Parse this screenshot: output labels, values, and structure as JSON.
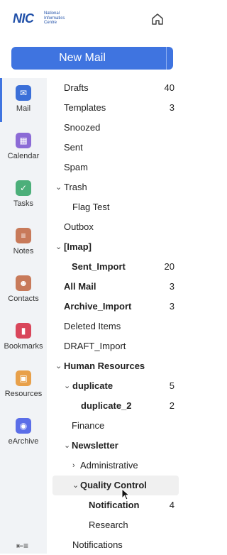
{
  "header": {
    "logo_mark": "NIC",
    "logo_text": "National Informatics Centre",
    "home_icon": "home-icon"
  },
  "compose": {
    "label": "New Mail",
    "dropdown_icon": "chevron-down-icon"
  },
  "colors": {
    "accent": "#3f74e0",
    "mail": "#3b6fd8",
    "calendar": "#8c6bd6",
    "tasks": "#4caf7a",
    "notes": "#c87a5a",
    "contacts": "#c87a5a",
    "bookmarks": "#d9465b",
    "resources": "#e8a04a",
    "earchive": "#5b6ee8"
  },
  "apps": [
    {
      "label": "Mail",
      "icon": "mail-icon"
    },
    {
      "label": "Calendar",
      "icon": "calendar-icon"
    },
    {
      "label": "Tasks",
      "icon": "tasks-icon"
    },
    {
      "label": "Notes",
      "icon": "notes-icon"
    },
    {
      "label": "Contacts",
      "icon": "contacts-icon"
    },
    {
      "label": "Bookmarks",
      "icon": "bookmark-icon"
    },
    {
      "label": "Resources",
      "icon": "resources-icon"
    },
    {
      "label": "eArchive",
      "icon": "archive-icon"
    }
  ],
  "collapse_icon": "collapse-sidebar-icon",
  "folders": [
    {
      "name": "Drafts",
      "count": "40"
    },
    {
      "name": "Templates",
      "count": "3"
    },
    {
      "name": "Snoozed",
      "count": ""
    },
    {
      "name": "Sent",
      "count": ""
    },
    {
      "name": "Spam",
      "count": ""
    },
    {
      "name": "Trash",
      "count": ""
    },
    {
      "name": "Flag Test",
      "count": ""
    },
    {
      "name": "Outbox",
      "count": ""
    },
    {
      "name": "[Imap]",
      "count": ""
    },
    {
      "name": "Sent_Import",
      "count": "20"
    },
    {
      "name": "All Mail",
      "count": "3"
    },
    {
      "name": "Archive_Import",
      "count": "3"
    },
    {
      "name": "Deleted Items",
      "count": ""
    },
    {
      "name": "DRAFT_Import",
      "count": ""
    },
    {
      "name": "Human Resources",
      "count": ""
    },
    {
      "name": "duplicate",
      "count": "5"
    },
    {
      "name": "duplicate_2",
      "count": "2"
    },
    {
      "name": "Finance",
      "count": ""
    },
    {
      "name": "Newsletter",
      "count": ""
    },
    {
      "name": "Administrative",
      "count": ""
    },
    {
      "name": "Quality Control",
      "count": ""
    },
    {
      "name": "Notification",
      "count": "4"
    },
    {
      "name": "Research",
      "count": ""
    },
    {
      "name": "Notifications",
      "count": ""
    }
  ]
}
